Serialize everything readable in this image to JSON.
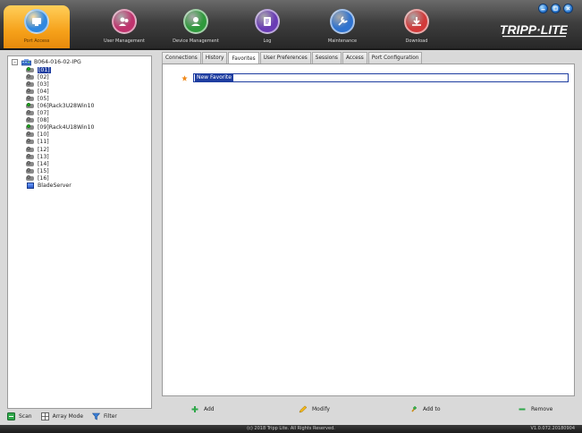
{
  "window_controls": [
    "minimize-icon",
    "maximize-icon",
    "close-icon"
  ],
  "nav": [
    {
      "label": "Port Access",
      "icon": "port-access-icon",
      "color": "#2f88e0",
      "active": true
    },
    {
      "label": "User Management",
      "icon": "user-management-icon",
      "color": "#c0336e",
      "active": false
    },
    {
      "label": "Device Management",
      "icon": "device-management-icon",
      "color": "#2f9a3c",
      "active": false
    },
    {
      "label": "Log",
      "icon": "log-icon",
      "color": "#6a3bb5",
      "active": false
    },
    {
      "label": "Maintenance",
      "icon": "maintenance-icon",
      "color": "#2f73d0",
      "active": false
    },
    {
      "label": "Download",
      "icon": "download-icon",
      "color": "#d23a3a",
      "active": false
    }
  ],
  "brand": {
    "text": "TRIPP·LITE"
  },
  "tree": {
    "expander": "–",
    "root_label": "B064-016-02-IPG",
    "items": [
      {
        "label": "[01]",
        "online": true,
        "selected": true
      },
      {
        "label": "[02]",
        "online": false
      },
      {
        "label": "[03]",
        "online": false
      },
      {
        "label": "[04]",
        "online": false
      },
      {
        "label": "[05]",
        "online": false
      },
      {
        "label": "[06]Rack3U28Win10",
        "online": true
      },
      {
        "label": "[07]",
        "online": false
      },
      {
        "label": "[08]",
        "online": false
      },
      {
        "label": "[09]Rack4U18Win10",
        "online": true
      },
      {
        "label": "[10]",
        "online": false
      },
      {
        "label": "[11]",
        "online": false
      },
      {
        "label": "[12]",
        "online": false
      },
      {
        "label": "[13]",
        "online": false
      },
      {
        "label": "[14]",
        "online": false
      },
      {
        "label": "[15]",
        "online": false
      },
      {
        "label": "[16]",
        "online": false
      }
    ],
    "blade_label": "BladeServer"
  },
  "left_toolbar": {
    "scan": "Scan",
    "array_mode": "Array Mode",
    "filter": "Filter"
  },
  "tabs": [
    {
      "label": "Connections",
      "active": false
    },
    {
      "label": "History",
      "active": false
    },
    {
      "label": "Favorites",
      "active": true
    },
    {
      "label": "User Preferences",
      "active": false
    },
    {
      "label": "Sessions",
      "active": false
    },
    {
      "label": "Access",
      "active": false
    },
    {
      "label": "Port Configuration",
      "active": false
    }
  ],
  "favorites": {
    "new_item_value": "New Favorite"
  },
  "actions": {
    "add": "Add",
    "modify": "Modify",
    "add_to": "Add to",
    "remove": "Remove"
  },
  "status": {
    "copyright": "(c) 2018 Tripp Lite. All Rights Reserved.",
    "version": "V1.0.072.20180904"
  }
}
